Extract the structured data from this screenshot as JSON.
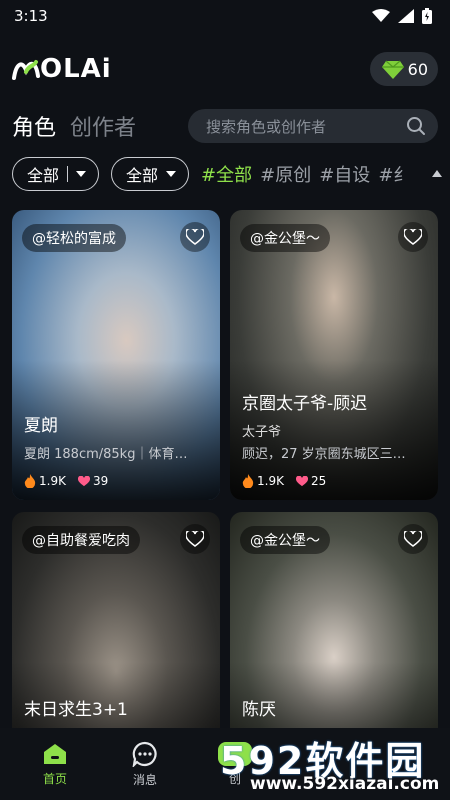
{
  "status_bar": {
    "time": "3:13"
  },
  "header": {
    "logo_text": "OLAi",
    "coins": "60"
  },
  "tabs": [
    {
      "label": "角色",
      "active": true
    },
    {
      "label": "创作者",
      "active": false
    }
  ],
  "search": {
    "placeholder": "搜索角色或创作者"
  },
  "filters": {
    "dropdown1": "全部",
    "dropdown2": "全部",
    "tags": [
      "#全部",
      "#原创",
      "#自设",
      "#纟"
    ]
  },
  "cards": [
    {
      "creator": "@轻松的富成",
      "name": "夏朗",
      "subtitle": "",
      "desc": "夏朗 188cm/85kg｜体育…",
      "heat": "1.9K",
      "likes": "39",
      "bg": "#6c8aa6"
    },
    {
      "creator": "@金公堡～",
      "name": "京圈太子爷-顾迟",
      "subtitle": "太子爷",
      "desc": "顾迟，27 岁京圈东城区三…",
      "heat": "1.9K",
      "likes": "25",
      "bg": "#4a4a46"
    },
    {
      "creator": "@自助餐爱吃肉",
      "name": "末日求生3+1",
      "subtitle": "",
      "desc": "",
      "heat": "",
      "likes": "",
      "bg": "#3a3b3a"
    },
    {
      "creator": "@金公堡～",
      "name": "陈厌",
      "subtitle": "",
      "desc": "",
      "heat": "",
      "likes": "",
      "bg": "#4b5046"
    }
  ],
  "bottom_nav": [
    {
      "label": "首页",
      "active": true
    },
    {
      "label": "消息",
      "active": false
    },
    {
      "label": "创",
      "active": false
    }
  ],
  "watermark": {
    "big": "592软件园",
    "small": "www.592xiazai.com"
  },
  "colors": {
    "accent": "#8ee04a",
    "background": "#0e1116",
    "heart": "#ff5b8a",
    "fire": "#ff8a1c"
  }
}
